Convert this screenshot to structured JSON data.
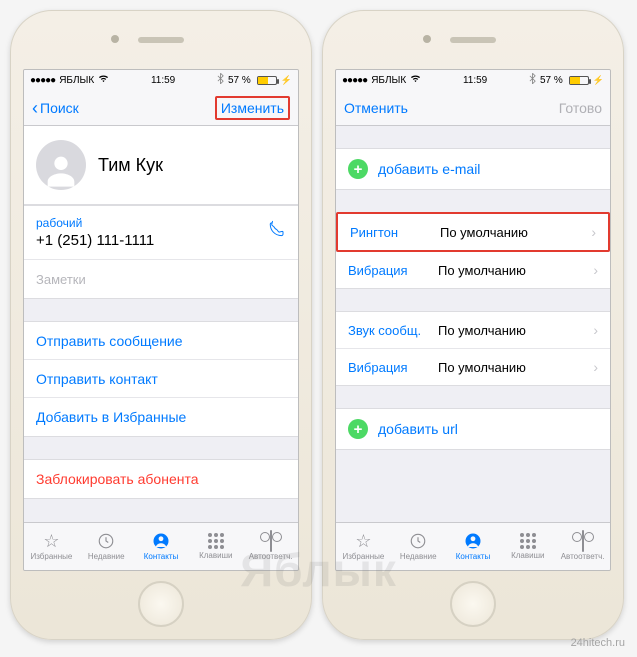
{
  "status": {
    "carrier": "ЯБЛЫК",
    "time": "11:59",
    "battery": "57 %"
  },
  "left": {
    "nav_back": "Поиск",
    "nav_right": "Изменить",
    "contact_name": "Тим Кук",
    "phone_label": "рабочий",
    "phone_number": "+1 (251) 111-1111",
    "notes": "Заметки",
    "actions": {
      "send_message": "Отправить сообщение",
      "send_contact": "Отправить контакт",
      "add_fav": "Добавить в Избранные",
      "block": "Заблокировать абонента"
    }
  },
  "right": {
    "nav_cancel": "Отменить",
    "nav_done": "Готово",
    "add_email": "добавить e-mail",
    "ringtone_label": "Рингтон",
    "ringtone_val": "По умолчанию",
    "vibration_label": "Вибрация",
    "vibration_val": "По умолчанию",
    "text_tone_label": "Звук сообщ.",
    "text_tone_val": "По умолчанию",
    "vibration2_label": "Вибрация",
    "vibration2_val": "По умолчанию",
    "add_url": "добавить url"
  },
  "tabs": {
    "fav": "Избранные",
    "recent": "Недавние",
    "contacts": "Контакты",
    "keypad": "Клавиши",
    "voicemail": "Автоответч."
  },
  "watermark": "Яблык",
  "credit": "24hitech.ru"
}
